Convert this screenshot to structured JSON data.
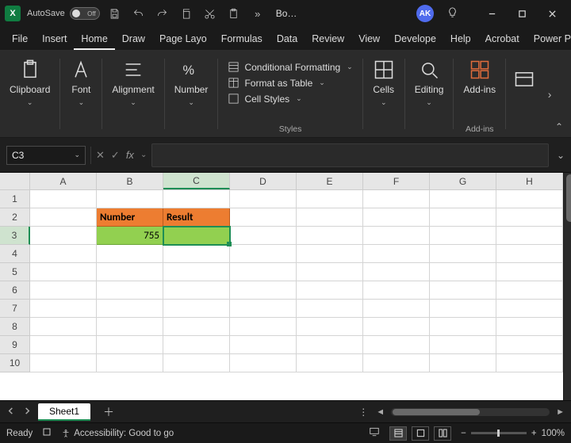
{
  "titlebar": {
    "autosave_label": "AutoSave",
    "autosave_state": "Off",
    "doc_title": "Bo…",
    "avatar_initials": "AK"
  },
  "menus": {
    "items": [
      "File",
      "Insert",
      "Home",
      "Draw",
      "Page Layo",
      "Formulas",
      "Data",
      "Review",
      "View",
      "Develope",
      "Help",
      "Acrobat",
      "Power Piv"
    ],
    "active_index": 2
  },
  "ribbon": {
    "clipboard": "Clipboard",
    "font": "Font",
    "alignment": "Alignment",
    "number": "Number",
    "cond_fmt": "Conditional Formatting",
    "fmt_table": "Format as Table",
    "cell_styles": "Cell Styles",
    "styles_label": "Styles",
    "cells": "Cells",
    "editing": "Editing",
    "addins": "Add-ins",
    "addins_label": "Add-ins"
  },
  "formula_bar": {
    "cell_ref": "C3",
    "formula": ""
  },
  "grid": {
    "columns": [
      "A",
      "B",
      "C",
      "D",
      "E",
      "F",
      "G",
      "H"
    ],
    "active_col_index": 2,
    "active_row_index": 2,
    "rows": 10,
    "cells": {
      "B2": {
        "text": "Number",
        "style": "hdr"
      },
      "C2": {
        "text": "Result",
        "style": "hdr"
      },
      "B3": {
        "text": "755",
        "style": "val"
      },
      "C3": {
        "text": "",
        "style": "valL",
        "active": true
      }
    }
  },
  "sheets": {
    "active": "Sheet1"
  },
  "status": {
    "ready": "Ready",
    "accessibility": "Accessibility: Good to go",
    "zoom": "100%"
  }
}
